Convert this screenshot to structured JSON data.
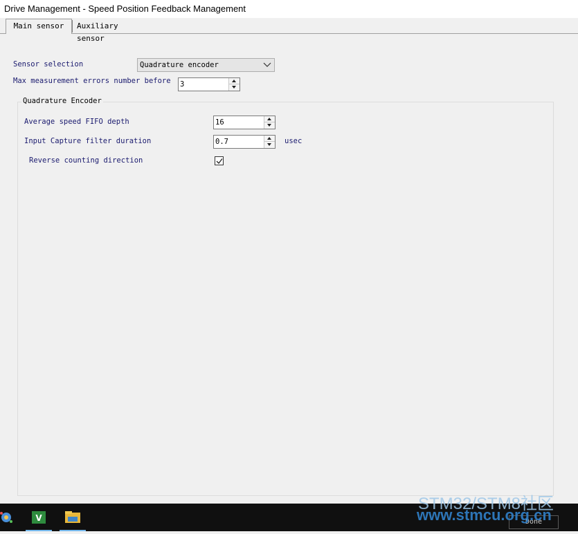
{
  "window": {
    "title": "Drive Management - Speed Position Feedback Management"
  },
  "tabs": [
    {
      "label": "Main sensor",
      "active": true
    },
    {
      "label": "Auxiliary sensor",
      "active": false
    }
  ],
  "main_sensor": {
    "sensor_selection_label": "Sensor selection",
    "sensor_selection_value": "Quadrature encoder",
    "max_errors_label": "Max measurement errors number before",
    "max_errors_value": "3",
    "group_title": "Quadrature Encoder",
    "fifo_label": "Average speed FIFO depth",
    "fifo_value": "16",
    "filter_label": "Input Capture filter duration",
    "filter_value": "0.7",
    "filter_unit": "usec",
    "reverse_label": "Reverse counting direction",
    "reverse_checked": true
  },
  "footer": {
    "done_label": "Done"
  },
  "watermark": {
    "line1": "STM32/STM8社区",
    "line2": "www.stmcu.org.cn"
  },
  "colors": {
    "label": "#1a1a6e",
    "window_bg": "#f0f0f0",
    "taskbar_bg": "#101010",
    "watermark": "#2f7bc0"
  },
  "taskbar": {
    "icons": [
      "settings-app-icon",
      "visual-studio-icon",
      "file-explorer-icon"
    ]
  }
}
